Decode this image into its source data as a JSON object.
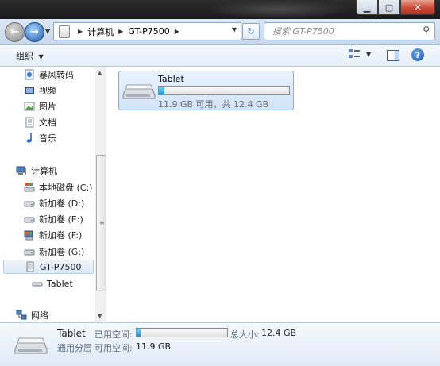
{
  "address": {
    "crumbs": [
      "计算机",
      "GT-P7500"
    ],
    "search_placeholder": "搜索 GT-P7500"
  },
  "toolbar": {
    "organize_label": "组织"
  },
  "sidebar": {
    "items": [
      {
        "label": "暴风转码",
        "icon": "media-app-icon"
      },
      {
        "label": "视频",
        "icon": "video-library-icon"
      },
      {
        "label": "图片",
        "icon": "picture-library-icon"
      },
      {
        "label": "文档",
        "icon": "document-library-icon"
      },
      {
        "label": "音乐",
        "icon": "music-library-icon"
      },
      {
        "label": "计算机",
        "icon": "computer-icon"
      },
      {
        "label": "本地磁盘 (C:)",
        "icon": "system-drive-icon"
      },
      {
        "label": "新加卷 (D:)",
        "icon": "drive-icon"
      },
      {
        "label": "新加卷 (E:)",
        "icon": "drive-icon"
      },
      {
        "label": "新加卷 (F:)",
        "icon": "network-drive-icon"
      },
      {
        "label": "新加卷 (G:)",
        "icon": "drive-icon"
      },
      {
        "label": "GT-P7500",
        "icon": "portable-device-icon",
        "selected": true
      },
      {
        "label": "Tablet",
        "icon": "storage-icon"
      },
      {
        "label": "网络",
        "icon": "network-icon"
      }
    ]
  },
  "main": {
    "storage": {
      "name": "Tablet",
      "free_text": "11.9 GB 可用，共 12.4 GB",
      "used_fraction": 0.04
    }
  },
  "details": {
    "name": "Tablet",
    "type": "通用分层",
    "used_label": "已用空间:",
    "free_label": "可用空间:",
    "free_value": "11.9 GB",
    "total_label": "总大小:",
    "total_value": "12.4 GB",
    "used_fraction": 0.04
  },
  "colors": {
    "accent": "#1d8fd0",
    "selection": "#d1e4f9"
  }
}
